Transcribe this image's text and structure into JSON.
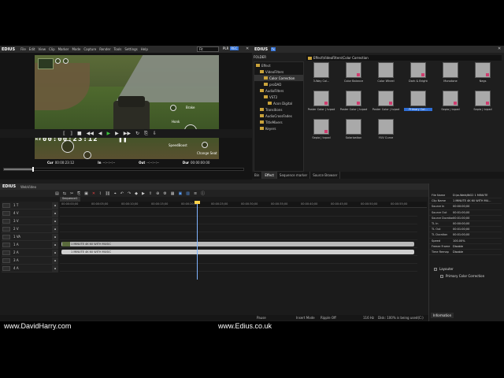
{
  "watermarks": {
    "left": "www.DavidHarry.com",
    "right": "www.Edius.co.uk"
  },
  "player": {
    "app_name": "EDIUS",
    "menu": [
      "File",
      "Edit",
      "View",
      "Clip",
      "Marker",
      "Mode",
      "Capture",
      "Render",
      "Tools",
      "Settings",
      "Help"
    ],
    "fit": "Fit",
    "plr": "PLR",
    "rec": "REC",
    "timecode": "00:00:23:12",
    "cur_label": "Cur",
    "in_label": "In",
    "out_label": "Out",
    "dur_label": "Dur",
    "cur_time": "00:00:23:12",
    "in_time": "--:--:--:--",
    "out_time": "--:--:--:--",
    "dur_time": "00:00:00:00",
    "hud": {
      "brake": "Brake",
      "honk": "Honk",
      "speed": "SpeedBoost",
      "change": "Change Seat",
      "rz": "Rz"
    },
    "scrub_progress": 0.12
  },
  "effects": {
    "app_name": "EDIUS",
    "tag": "fx",
    "folder_label": "FOLDER",
    "path": "Effect\\VideoFilters\\Color Correction",
    "tree": [
      {
        "label": "Effect",
        "indent": 0,
        "selected": false
      },
      {
        "label": "VideoFilters",
        "indent": 1,
        "selected": false
      },
      {
        "label": "Color Correction",
        "indent": 2,
        "selected": true
      },
      {
        "label": "proDAD",
        "indent": 2,
        "selected": false
      },
      {
        "label": "AudioFilters",
        "indent": 1,
        "selected": false
      },
      {
        "label": "VST2",
        "indent": 2,
        "selected": false
      },
      {
        "label": "Acon Digital",
        "indent": 3,
        "selected": false
      },
      {
        "label": "Transitions",
        "indent": 1,
        "selected": false
      },
      {
        "label": "AudioCrossFades",
        "indent": 1,
        "selected": false
      },
      {
        "label": "TitleMixers",
        "indent": 1,
        "selected": false
      },
      {
        "label": "Keyers",
        "indent": 1,
        "selected": false
      }
    ],
    "items": [
      {
        "label": "3-Way Col...",
        "marked": false,
        "selected": false
      },
      {
        "label": "Color Balance",
        "marked": true,
        "selected": false
      },
      {
        "label": "Color Wheel",
        "marked": false,
        "selected": false
      },
      {
        "label": "Dark & Bright",
        "marked": true,
        "selected": false
      },
      {
        "label": "Monotone",
        "marked": false,
        "selected": false
      },
      {
        "label": "Negs",
        "marked": true,
        "selected": false
      },
      {
        "label": "Poster Color | tvpad",
        "marked": true,
        "selected": false
      },
      {
        "label": "Poster Color | tvpad",
        "marked": true,
        "selected": false
      },
      {
        "label": "Poster Color | tvpad",
        "marked": true,
        "selected": false
      },
      {
        "label": "Primary Col...",
        "marked": false,
        "selected": true
      },
      {
        "label": "Sepia | tvpad",
        "marked": true,
        "selected": false
      },
      {
        "label": "Sepia | tvpad",
        "marked": true,
        "selected": false
      },
      {
        "label": "Sepia | tvpad",
        "marked": true,
        "selected": false
      },
      {
        "label": "Solarization",
        "marked": false,
        "selected": false
      },
      {
        "label": "YUV Curve",
        "marked": false,
        "selected": false
      }
    ],
    "tabs": [
      "Bin",
      "Effect",
      "Sequence marker",
      "Source Browser"
    ],
    "active_tab": 1
  },
  "timeline": {
    "app_name": "EDIUS",
    "project": "WebVideo",
    "sequence_tab": "Sequence1",
    "ruler": [
      "00:00:00;00",
      "00:00:05;00",
      "00:00:10;00",
      "00:00:15;00",
      "00:00:20;00",
      "00:00:25;00",
      "00:00:30;00",
      "00:00:35;00",
      "00:00:40;00",
      "00:00:45;00",
      "00:00:50;00",
      "00:00:55;00"
    ],
    "tracks": [
      {
        "name": "1 T"
      },
      {
        "name": "4 V"
      },
      {
        "name": "3 V"
      },
      {
        "name": "2 V"
      },
      {
        "name": "1 VA"
      },
      {
        "name": "1 A"
      },
      {
        "name": "2 A"
      },
      {
        "name": "3 A"
      },
      {
        "name": "4 A"
      }
    ],
    "clips": [
      {
        "label": "1 MINUTE 4K 60 WITH MUSIC",
        "lane": 5,
        "kind": "video"
      },
      {
        "label": "1 MINUTE 4K 60 WITH MUSIC",
        "lane": 6,
        "kind": "audio"
      }
    ],
    "status": {
      "pause": "Pause",
      "insert": "Insert Mode",
      "ripple": "Ripple Off",
      "rate": "116 Hz",
      "disk": "Disk: 100% is being used(C:)"
    }
  },
  "info": {
    "rows": [
      {
        "k": "File Name",
        "v": "D:\\w-Web\\ING2 1 MINUTE"
      },
      {
        "k": "Clip Name",
        "v": "1 MINUTE 4K 60 WITH MU..."
      },
      {
        "k": "Source In",
        "v": "00:00:00;00"
      },
      {
        "k": "Source Out",
        "v": "00:01:00;00"
      },
      {
        "k": "Source Duration",
        "v": "00:01:00;00"
      },
      {
        "k": "TL In",
        "v": "00:00:00;00"
      },
      {
        "k": "TL Out",
        "v": "00:01:00;00"
      },
      {
        "k": "TL Duration",
        "v": "00:01:00;00"
      },
      {
        "k": "Speed",
        "v": "100.00%"
      },
      {
        "k": "Freeze Frame",
        "v": "Disable"
      },
      {
        "k": "Time Remap",
        "v": "Disable"
      }
    ],
    "effects": [
      "Layouter",
      "Primary Color Correction"
    ],
    "tab": "Information"
  }
}
